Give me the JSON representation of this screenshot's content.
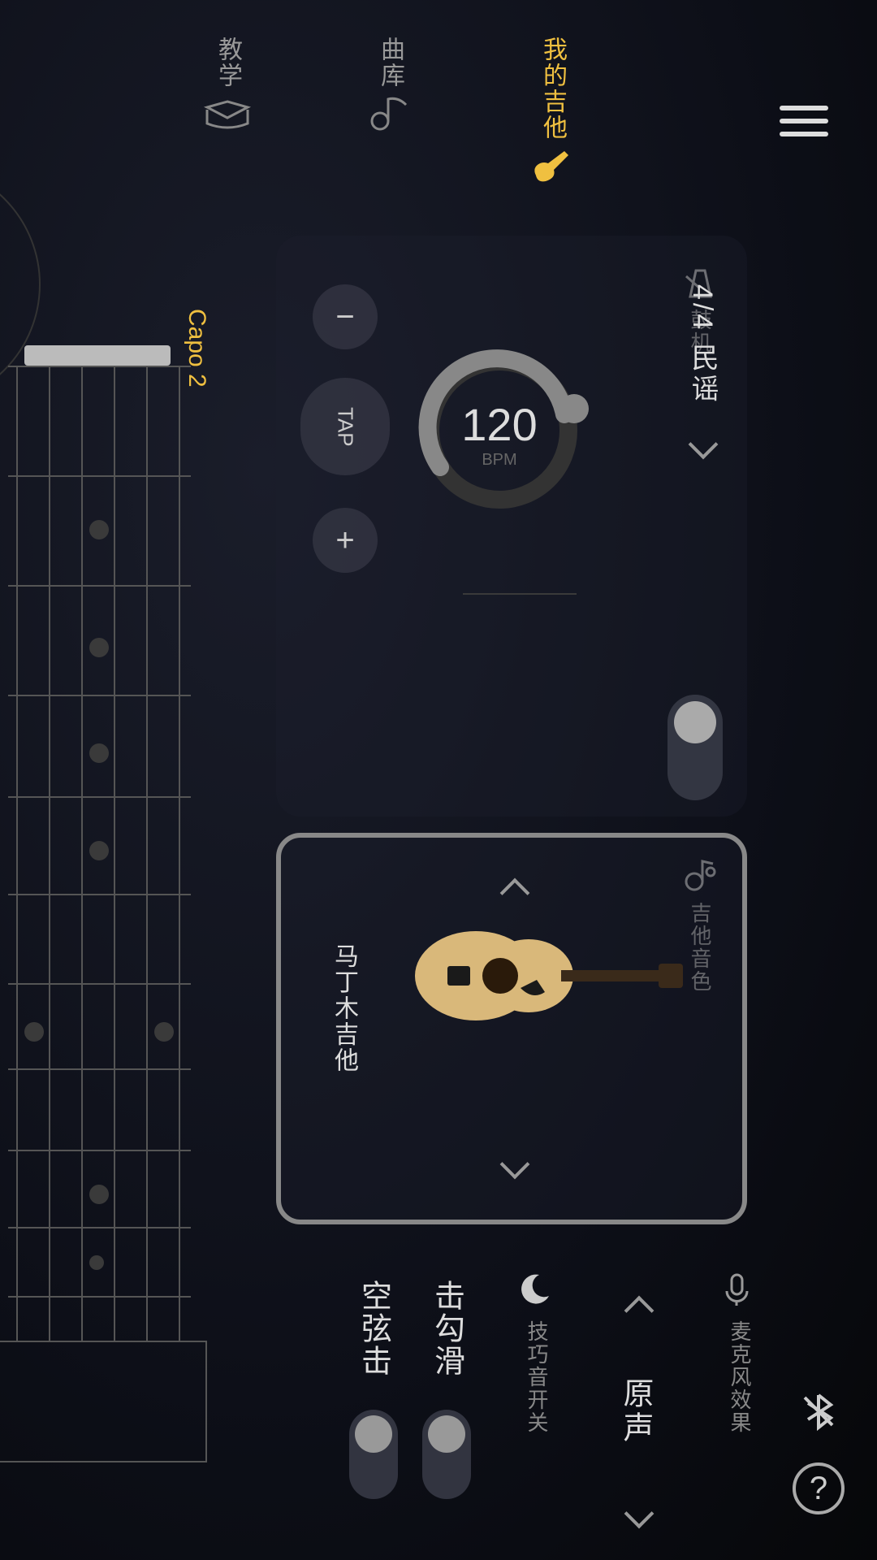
{
  "nav": {
    "tab1": "教学",
    "tab2": "曲库",
    "tab3": "我的吉他"
  },
  "fretboard": {
    "capo_label": "Capo 2"
  },
  "drum": {
    "header": "鼓机",
    "preset": "4/4 民谣",
    "bpm_value": "120",
    "bpm_label": "BPM",
    "minus": "−",
    "plus": "+",
    "tap": "TAP"
  },
  "tone": {
    "header": "吉他音色",
    "name": "马丁木吉他"
  },
  "technique": {
    "header": "技巧音开关",
    "row1": "击勾滑",
    "row2": "空弦击"
  },
  "mic": {
    "header": "麦克风效果",
    "value": "原声"
  },
  "help": "?"
}
